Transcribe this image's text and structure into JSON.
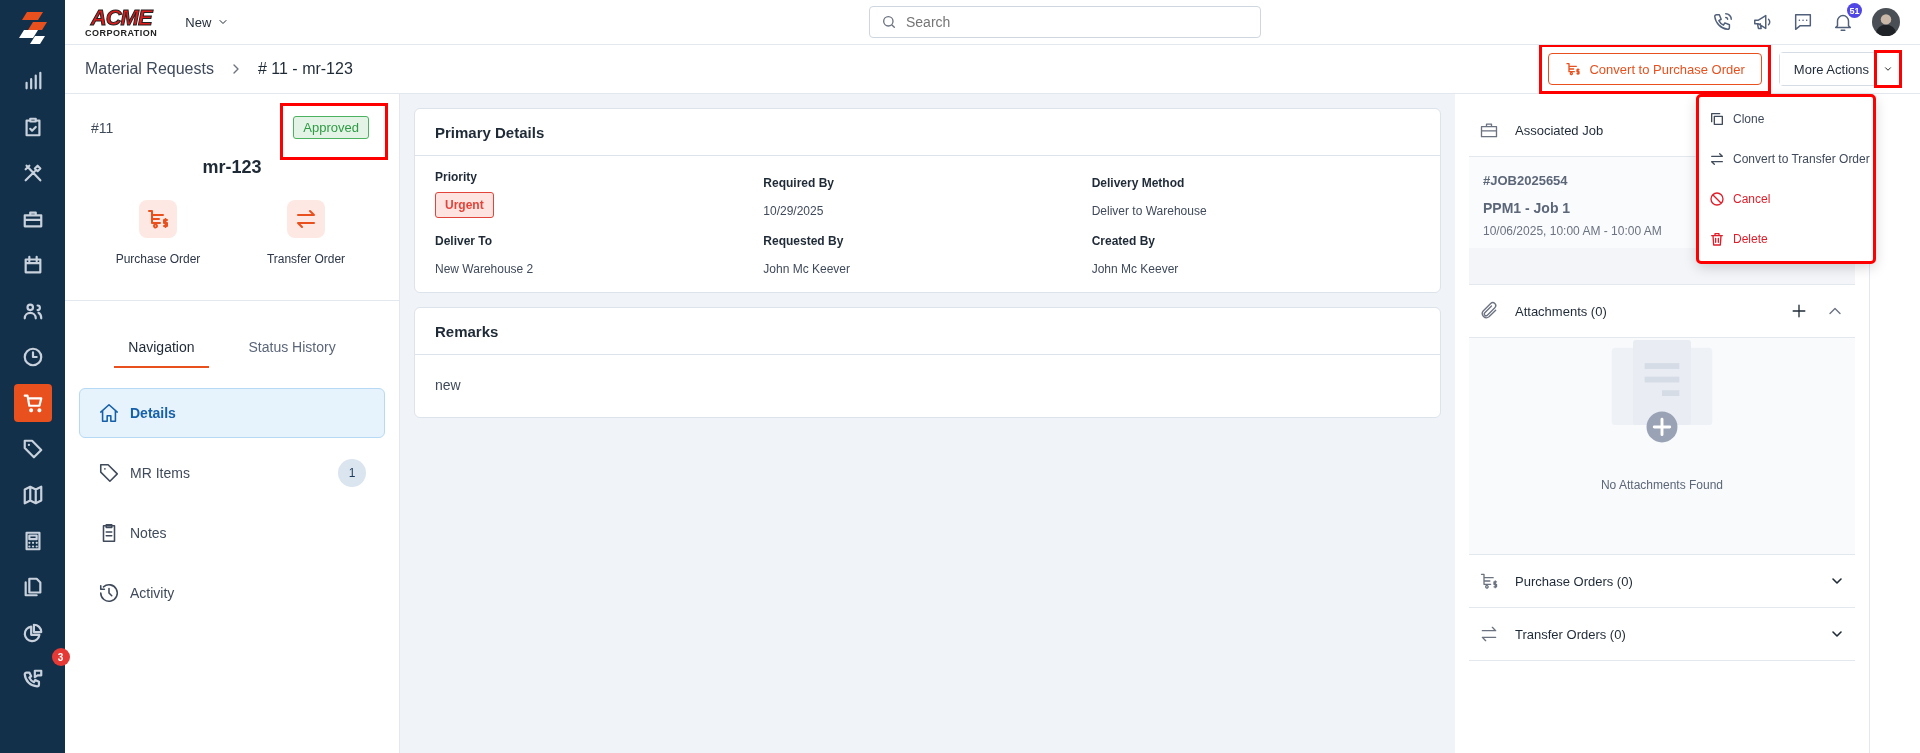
{
  "sidebar": {
    "items": [
      {
        "kind": "chart",
        "selected": false
      },
      {
        "kind": "clipboard",
        "selected": false
      },
      {
        "kind": "tools",
        "selected": false
      },
      {
        "kind": "briefcase",
        "selected": false
      },
      {
        "kind": "calendar",
        "selected": false
      },
      {
        "kind": "users",
        "selected": false
      },
      {
        "kind": "clock",
        "selected": false
      },
      {
        "kind": "cart",
        "selected": true
      },
      {
        "kind": "tag",
        "selected": false
      },
      {
        "kind": "map",
        "selected": false
      },
      {
        "kind": "calculator",
        "selected": false
      },
      {
        "kind": "files",
        "selected": false
      },
      {
        "kind": "pie",
        "selected": false
      },
      {
        "kind": "phonechat",
        "selected": false,
        "badge": "3"
      }
    ]
  },
  "header": {
    "logo_text": "ACME",
    "logo_subtext": "CORPORATION",
    "new_menu": "New",
    "search": {
      "placeholder": "Search"
    },
    "notification_count": "51"
  },
  "breadcrumb": [
    "Material Requests",
    "# 11 - mr-123"
  ],
  "actions": {
    "primary": {
      "label": "Convert to Purchase Order",
      "highlighted": true
    },
    "more": {
      "label": "More Actions"
    },
    "more_toggle": {
      "highlighted": true
    },
    "menu": {
      "highlighted": true,
      "items": [
        {
          "label": "Clone",
          "kind": "clone",
          "danger": false
        },
        {
          "label": "Convert to Transfer Order",
          "kind": "transfer",
          "danger": false
        },
        {
          "label": "Cancel",
          "kind": "ban",
          "danger": true
        },
        {
          "label": "Delete",
          "kind": "trash",
          "danger": true
        }
      ]
    }
  },
  "record": {
    "number": "#11",
    "status": {
      "label": "Approved",
      "highlighted": true
    },
    "title": "mr-123",
    "quick_actions": [
      {
        "label": "Purchase Order",
        "kind": "purchase"
      },
      {
        "label": "Transfer Order",
        "kind": "transfer"
      }
    ]
  },
  "tabs": [
    {
      "label": "Navigation",
      "selected": true
    },
    {
      "label": "Status History",
      "selected": false
    }
  ],
  "nav_items": [
    {
      "label": "Details",
      "kind": "home",
      "selected": true
    },
    {
      "label": "MR Items",
      "kind": "tag",
      "selected": false,
      "count": "1"
    },
    {
      "label": "Notes",
      "kind": "notes",
      "selected": false
    },
    {
      "label": "Activity",
      "kind": "history",
      "selected": false
    }
  ],
  "primary_details": {
    "title": "Primary Details",
    "fields": [
      {
        "label": "Priority",
        "value": "Urgent",
        "kind": "badge"
      },
      {
        "label": "Required By",
        "value": "10/29/2025",
        "kind": "text"
      },
      {
        "label": "Delivery Method",
        "value": "Deliver to Warehouse",
        "kind": "text"
      },
      {
        "label": "Deliver To",
        "value": "New Warehouse 2",
        "kind": "text"
      },
      {
        "label": "Requested By",
        "value": "John Mc Keever",
        "kind": "text"
      },
      {
        "label": "Created By",
        "value": "John Mc Keever",
        "kind": "text"
      }
    ]
  },
  "remarks": {
    "title": "Remarks",
    "text": "new"
  },
  "associated_job": {
    "title": "Associated Job",
    "job_number": "#JOB2025654",
    "job_title": "PPM1 - Job 1",
    "time": "10/06/2025, 10:00 AM - 10:00 AM"
  },
  "attachments": {
    "title": "Attachments (0)",
    "expanded": true,
    "empty_text": "No Attachments Found"
  },
  "related": [
    {
      "title": "Purchase Orders (0)",
      "kind": "purchase",
      "expanded": false
    },
    {
      "title": "Transfer Orders (0)",
      "kind": "transfer",
      "expanded": false
    }
  ]
}
